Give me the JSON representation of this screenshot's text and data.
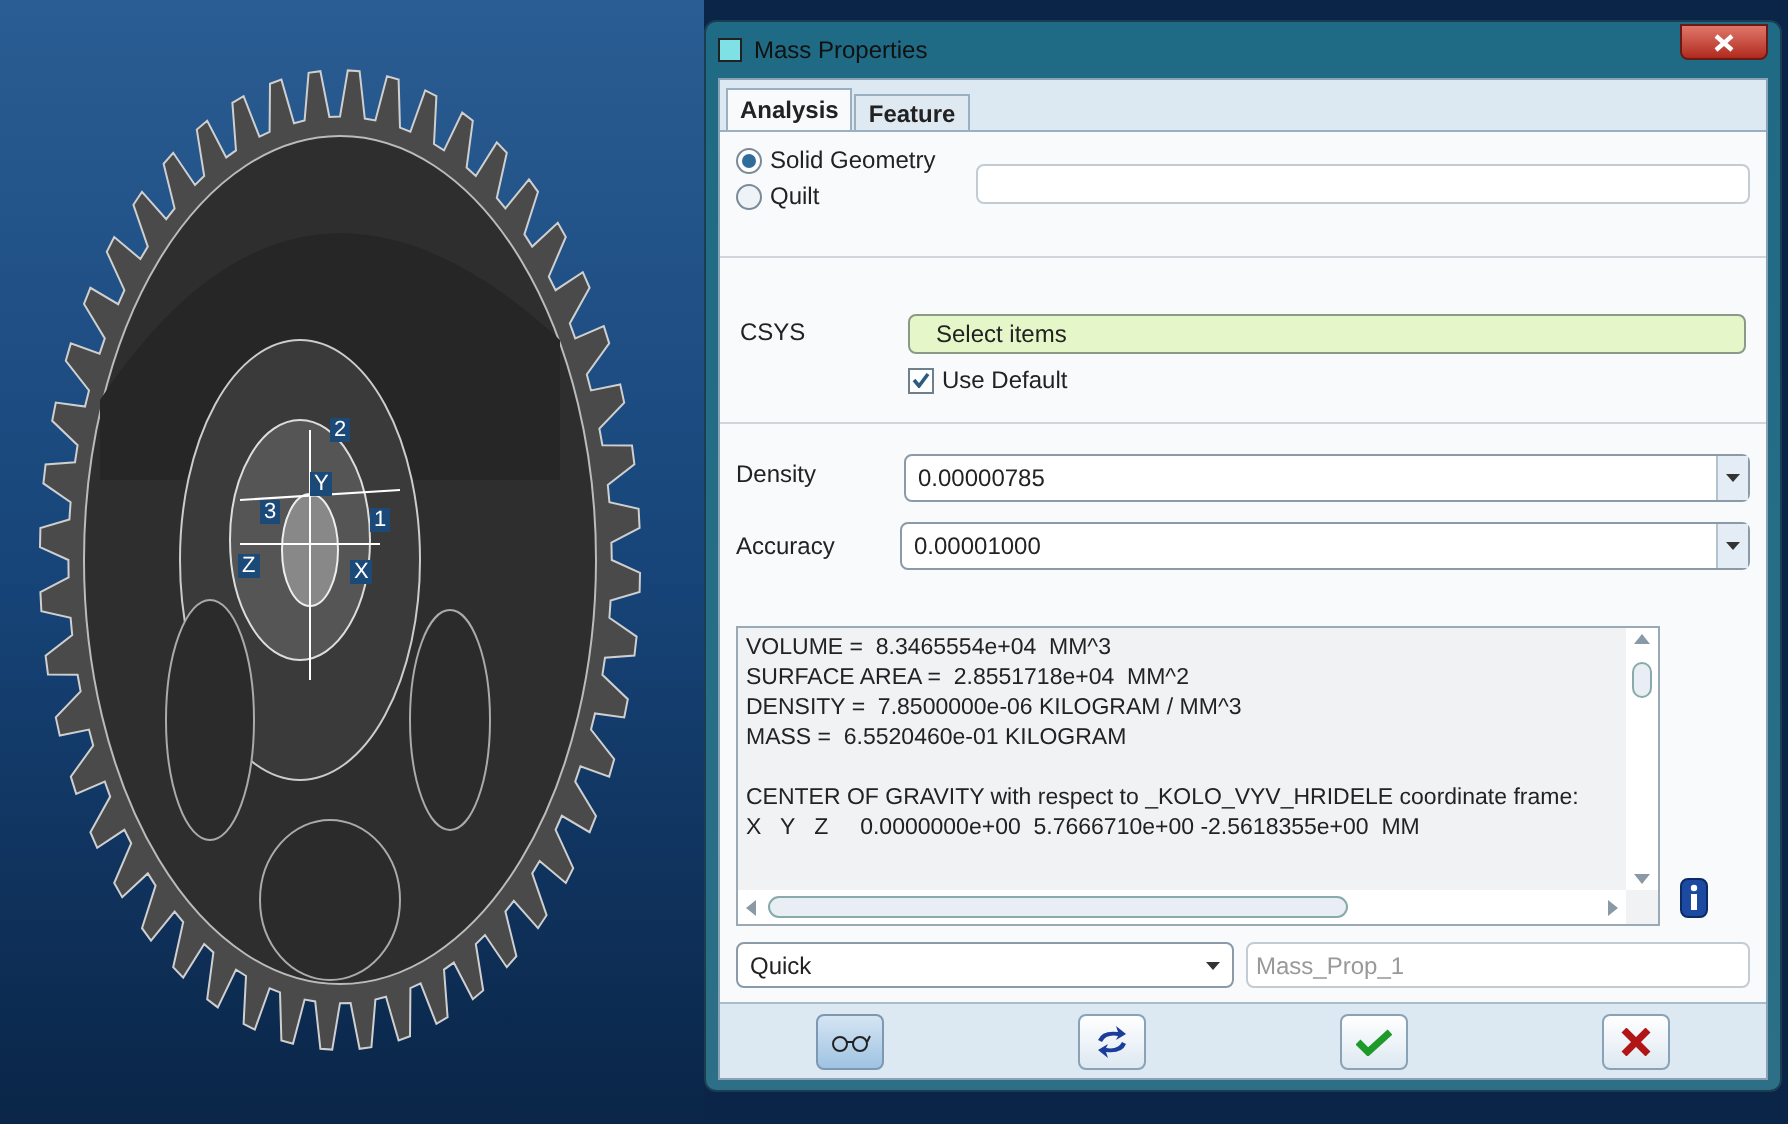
{
  "viewport": {
    "axis_labels": [
      "2",
      "Y",
      "3",
      "1",
      "Z",
      "X"
    ]
  },
  "dialog": {
    "title": "Mass Properties",
    "tabs": [
      {
        "label": "Analysis",
        "selected": true
      },
      {
        "label": "Feature",
        "selected": false
      }
    ],
    "geometry_options": [
      {
        "label": "Solid Geometry",
        "selected": true
      },
      {
        "label": "Quilt",
        "selected": false
      }
    ],
    "csys": {
      "label": "CSYS",
      "collector": "Select items",
      "use_default": {
        "label": "Use Default",
        "checked": true
      }
    },
    "density": {
      "label": "Density",
      "value": "0.00000785"
    },
    "accuracy": {
      "label": "Accuracy",
      "value": "0.00001000"
    },
    "results": [
      {
        "lines": [
          "VOLUME =  8.3465554e+04  MM^3",
          "SURFACE AREA =  2.8551718e+04  MM^2",
          "DENSITY =  7.8500000e-06 KILOGRAM / MM^3",
          "MASS =  6.5520460e-01 KILOGRAM"
        ]
      },
      {
        "lines": [
          "CENTER OF GRAVITY with respect to _KOLO_VYV_HRIDELE coordinate frame:",
          "X   Y   Z     0.0000000e+00  5.7666710e+00 -2.5618355e+00  MM"
        ]
      }
    ],
    "mode": {
      "value": "Quick"
    },
    "feature_name": {
      "placeholder": "Mass_Prop_1"
    }
  }
}
